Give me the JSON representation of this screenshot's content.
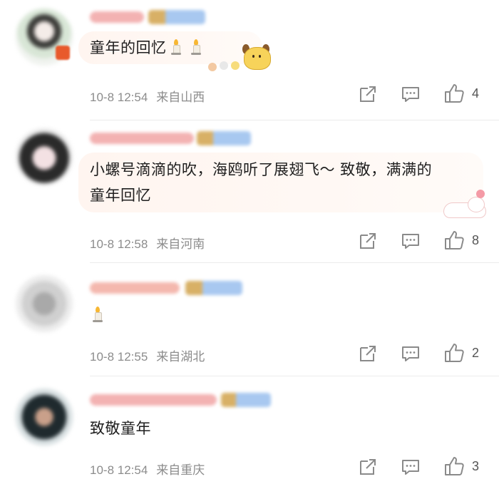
{
  "comments": [
    {
      "text": "童年的回忆",
      "date": "10-8 12:54",
      "location": "来自山西",
      "likes": "4",
      "emoji": [
        "candle",
        "candle"
      ],
      "decoration": "pompompurin-sticker"
    },
    {
      "text_line1": "小螺号滴滴的吹，海鸥听了展翅飞～ 致敬，满满的",
      "text_line2": "童年回忆",
      "date": "10-8 12:58",
      "location": "来自河南",
      "likes": "8",
      "decoration": "sleeping-cat-sticker"
    },
    {
      "text": "",
      "date": "10-8 12:55",
      "location": "来自湖北",
      "likes": "2",
      "emoji": [
        "candle"
      ]
    },
    {
      "text": "致敬童年",
      "date": "10-8 12:54",
      "location": "来自重庆",
      "likes": "3"
    }
  ],
  "icons": {
    "share": "share-icon",
    "comment": "comment-icon",
    "like": "thumbs-up-icon"
  },
  "colors": {
    "meta_text": "#8c8c8c",
    "bubble": "#fff6f1",
    "icon": "#8a8a8a"
  }
}
